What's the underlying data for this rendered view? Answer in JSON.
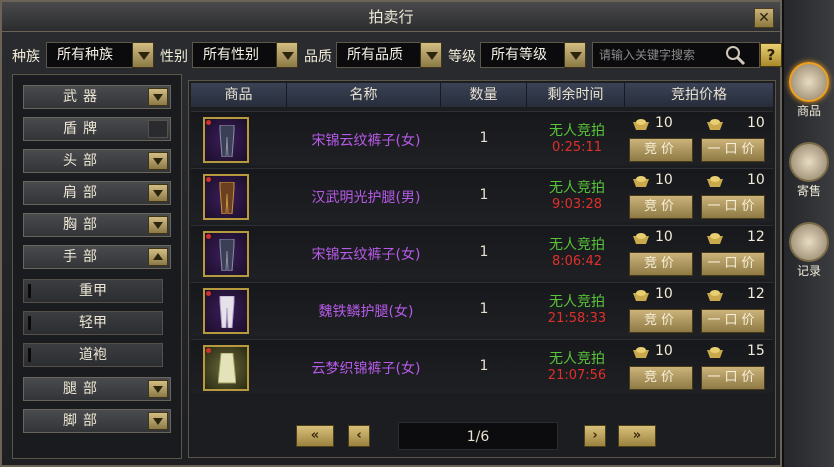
{
  "window": {
    "title": "拍卖行"
  },
  "filters": [
    {
      "label": "种族",
      "value": "所有种族"
    },
    {
      "label": "性别",
      "value": "所有性别"
    },
    {
      "label": "品质",
      "value": "所有品质"
    },
    {
      "label": "等级",
      "value": "所有等级"
    }
  ],
  "search": {
    "placeholder": "请输入关键字搜索",
    "help": "?"
  },
  "categories": [
    {
      "label": "武器",
      "arrow": "down"
    },
    {
      "label": "盾牌",
      "arrow": "none"
    },
    {
      "label": "头部",
      "arrow": "down"
    },
    {
      "label": "肩部",
      "arrow": "down"
    },
    {
      "label": "胸部",
      "arrow": "down"
    },
    {
      "label": "手部",
      "arrow": "up"
    },
    {
      "label": "重甲",
      "sub": true
    },
    {
      "label": "轻甲",
      "sub": true
    },
    {
      "label": "道袍",
      "sub": true
    },
    {
      "label": "腿部",
      "arrow": "down"
    },
    {
      "label": "脚部",
      "arrow": "down"
    }
  ],
  "table": {
    "headers": [
      "商品",
      "名称",
      "数量",
      "剩余时间",
      "竞拍价格"
    ],
    "rows": [
      {
        "name": "宋锦云纹裤子(女)",
        "qty": "1",
        "status": "无人竞拍",
        "time": "0:25:11",
        "bid": "10",
        "buyout": "10",
        "bid_btn": "竞价",
        "buy_btn": "一口价"
      },
      {
        "name": "汉武明光护腿(男)",
        "qty": "1",
        "status": "无人竞拍",
        "time": "9:03:28",
        "bid": "10",
        "buyout": "10",
        "bid_btn": "竞价",
        "buy_btn": "一口价"
      },
      {
        "name": "宋锦云纹裤子(女)",
        "qty": "1",
        "status": "无人竞拍",
        "time": "8:06:42",
        "bid": "10",
        "buyout": "12",
        "bid_btn": "竞价",
        "buy_btn": "一口价"
      },
      {
        "name": "魏铁鳞护腿(女)",
        "qty": "1",
        "status": "无人竞拍",
        "time": "21:58:33",
        "bid": "10",
        "buyout": "12",
        "bid_btn": "竞价",
        "buy_btn": "一口价"
      },
      {
        "name": "云梦织锦裤子(女)",
        "qty": "1",
        "status": "无人竞拍",
        "time": "21:07:56",
        "bid": "10",
        "buyout": "15",
        "bid_btn": "竞价",
        "buy_btn": "一口价"
      }
    ]
  },
  "pager": {
    "first": "«",
    "prev": "‹",
    "page": "1/6",
    "next": "›",
    "last": "»"
  },
  "sidebar": [
    {
      "label": "商品",
      "icon": "goods-icon",
      "active": true
    },
    {
      "label": "寄售",
      "icon": "consign-icon"
    },
    {
      "label": "记录",
      "icon": "record-icon"
    }
  ],
  "colors": {
    "item_name": "#b65ae8",
    "status": "#58c43a",
    "time": "#e0302a",
    "gold": "#c9a94c"
  }
}
